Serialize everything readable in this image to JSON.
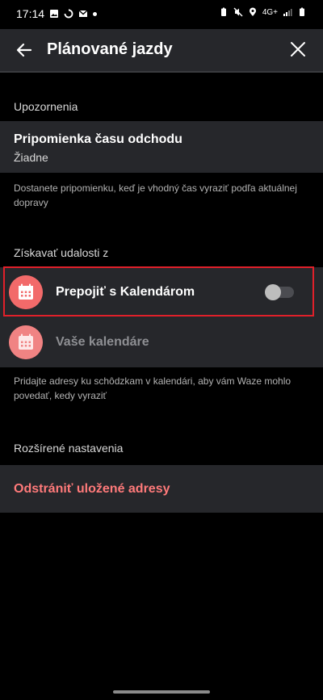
{
  "status_bar": {
    "time": "17:14",
    "network": "4G+",
    "icons_left": [
      "image-icon",
      "sync-icon",
      "gmail-icon",
      "dot-icon"
    ],
    "icons_right": [
      "battery-saver-icon",
      "mute-icon",
      "location-icon",
      "signal-icon",
      "battery-icon"
    ]
  },
  "app_bar": {
    "title": "Plánované jazdy",
    "back_icon": "arrow-left-icon",
    "close_icon": "close-icon"
  },
  "sections": {
    "notifications": {
      "label": "Upozornenia",
      "item_title": "Pripomienka času odchodu",
      "item_value": "Žiadne",
      "helper": "Dostanete pripomienku, keď je vhodný čas vyraziť podľa aktuálnej dopravy"
    },
    "events": {
      "label": "Získavať udalosti z",
      "connect_label": "Prepojiť s Kalendárom",
      "connect_enabled": false,
      "calendars_label": "Vaše kalendáre",
      "helper": "Pridajte adresy ku schôdzkam v kalendári, aby vám Waze mohlo povedať, kedy vyraziť"
    },
    "advanced": {
      "label": "Rozšírené nastavenia",
      "remove_label": "Odstrániť uložené adresy"
    }
  },
  "colors": {
    "background": "#000000",
    "card": "#26272b",
    "accent_red": "#ff7a7a",
    "calendar_icon_bg": "#f26a6a",
    "highlight_border": "#e0202a"
  }
}
